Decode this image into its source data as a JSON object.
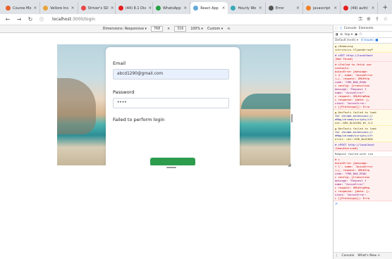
{
  "browser": {
    "tabs": [
      {
        "title": "Course Mo",
        "color": "#e8632c"
      },
      {
        "title": "Vellore Ins",
        "color": "#e8a33a"
      },
      {
        "title": "Striver's SD",
        "color": "#e84848"
      },
      {
        "title": "(44) 8.1 Div",
        "color": "#e61e1e"
      },
      {
        "title": "WhatsApp",
        "color": "#25a244"
      },
      {
        "title": "React App",
        "color": "#61a8d8",
        "active": true
      },
      {
        "title": "Hourly Wo",
        "color": "#3aa9b8"
      },
      {
        "title": "Error",
        "color": "#555555"
      },
      {
        "title": "javascript",
        "color": "#f48024"
      },
      {
        "title": "(49) auth/",
        "color": "#e61e1e"
      }
    ],
    "new_tab": "+",
    "url_host": "localhost",
    "url_path": ":3000/login"
  },
  "devtoolbar": {
    "dimensions_label": "Dimensions: Responsive ▾",
    "width": "768",
    "x": "×",
    "height": "316",
    "zoom": "100% ▾",
    "throttle": "Custom ▾"
  },
  "login": {
    "email_label": "Email",
    "email_value": "abcd1290@gmail.com",
    "password_label": "Password",
    "password_value": "••••",
    "error_message": "Failed to perform login",
    "button_color": "#2d9c4d"
  },
  "devtools": {
    "tabs": [
      "Console",
      "Elements"
    ],
    "context": "top ▾",
    "filter_placeholder": "Fi",
    "levels": "Default levels ▾",
    "issues": "4 Issues: ■",
    "entries": [
      {
        "kind": "warn",
        "lines": [
          "▲ ▸Removing",
          "intrinsics.%TypedArrayP"
        ]
      },
      {
        "kind": "err",
        "lines": [
          "⊗ ▸GET http://localhost",
          "(Not Found)"
        ]
      },
      {
        "kind": "err",
        "lines": [
          "⊗ ▸Failed to fetch   use",
          "contacts:",
          "  AxiosError {message:",
          "▾ 4', name: 'AxiosError",
          "  (…), request: XMLHttp",
          "    code: \"ERR_BAD_REQU",
          "  ▸ config: {transition",
          "    message: \"Request f",
          "    name: \"AxiosError\"",
          "  ▸ request: XMLHttpReq",
          "  ▸ response: {data: {…",
          "    stack: \"AxiosError:",
          "  ▸ [[Prototype]]: Erro"
        ]
      },
      {
        "kind": "warn",
        "lines": [
          "▲ DevTools failed to load",
          "for chrome-extension://",
          "eMap/chrome/scripts/ifr",
          "net::ERR_BLOCKED_BY_CLI"
        ]
      },
      {
        "kind": "warn",
        "lines": [
          "▲ DevTools failed to load",
          "for chrome-extension://",
          "eMap/chrome/scripts/ifr",
          "error: net::ERR_BLOCKED"
        ]
      },
      {
        "kind": "err",
        "lines": [
          "⊗ ▸POST http://localhost",
          "(Unauthorized)"
        ]
      },
      {
        "kind": "plain",
        "lines": [
          "Request failed with sta"
        ]
      },
      {
        "kind": "err",
        "lines": [
          "⊗ ▸",
          "  AxiosError {message:",
          "▾ 1', name: 'AxiosError",
          "  (…), request: XMLHttp",
          "    code: \"ERR_BAD_REQU",
          "  ▸ config: {transition",
          "    message: \"Request f",
          "    name: \"AxiosError\"",
          "  ▸ request: XMLHttpReq",
          "  ▸ response: {data: {…",
          "    stack: \"AxiosError:",
          "  ▸ [[Prototype]]: Erro"
        ]
      }
    ],
    "prompt": ">",
    "bottom_tabs": [
      "Console",
      "What's New ×"
    ]
  }
}
